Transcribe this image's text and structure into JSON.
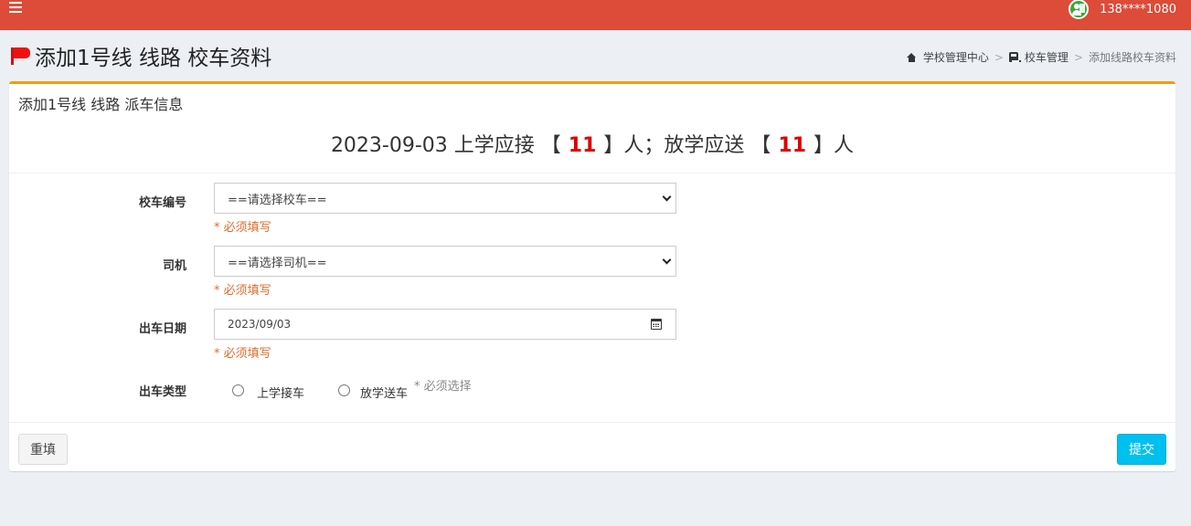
{
  "header": {
    "user_phone": "138****1080",
    "brand_color": "#dd4b39"
  },
  "page": {
    "title": "添加1号线 线路 校车资料"
  },
  "breadcrumb": {
    "items": [
      "学校管理中心",
      "校车管理",
      "添加线路校车资料"
    ]
  },
  "panel": {
    "title": "添加1号线 线路 派车信息",
    "summary": {
      "date": "2023-09-03",
      "pickup_prefix": "上学应接 【",
      "pickup_count": "11",
      "pickup_suffix": "】人；放学应送 【",
      "dropoff_count": "11",
      "dropoff_suffix": "】人"
    }
  },
  "form": {
    "bus": {
      "label": "校车编号",
      "value": "==请选择校车==",
      "hint": "* 必须填写"
    },
    "driver": {
      "label": "司机",
      "value": "==请选择司机==",
      "hint": "* 必须填写"
    },
    "date": {
      "label": "出车日期",
      "value": "2023/09/03",
      "hint": "* 必须填写"
    },
    "trip_type": {
      "label": "出车类型",
      "options": [
        "上学接车",
        "放学送车"
      ],
      "hint": "* 必须选择"
    }
  },
  "buttons": {
    "reset": "重填",
    "submit": "提交"
  }
}
